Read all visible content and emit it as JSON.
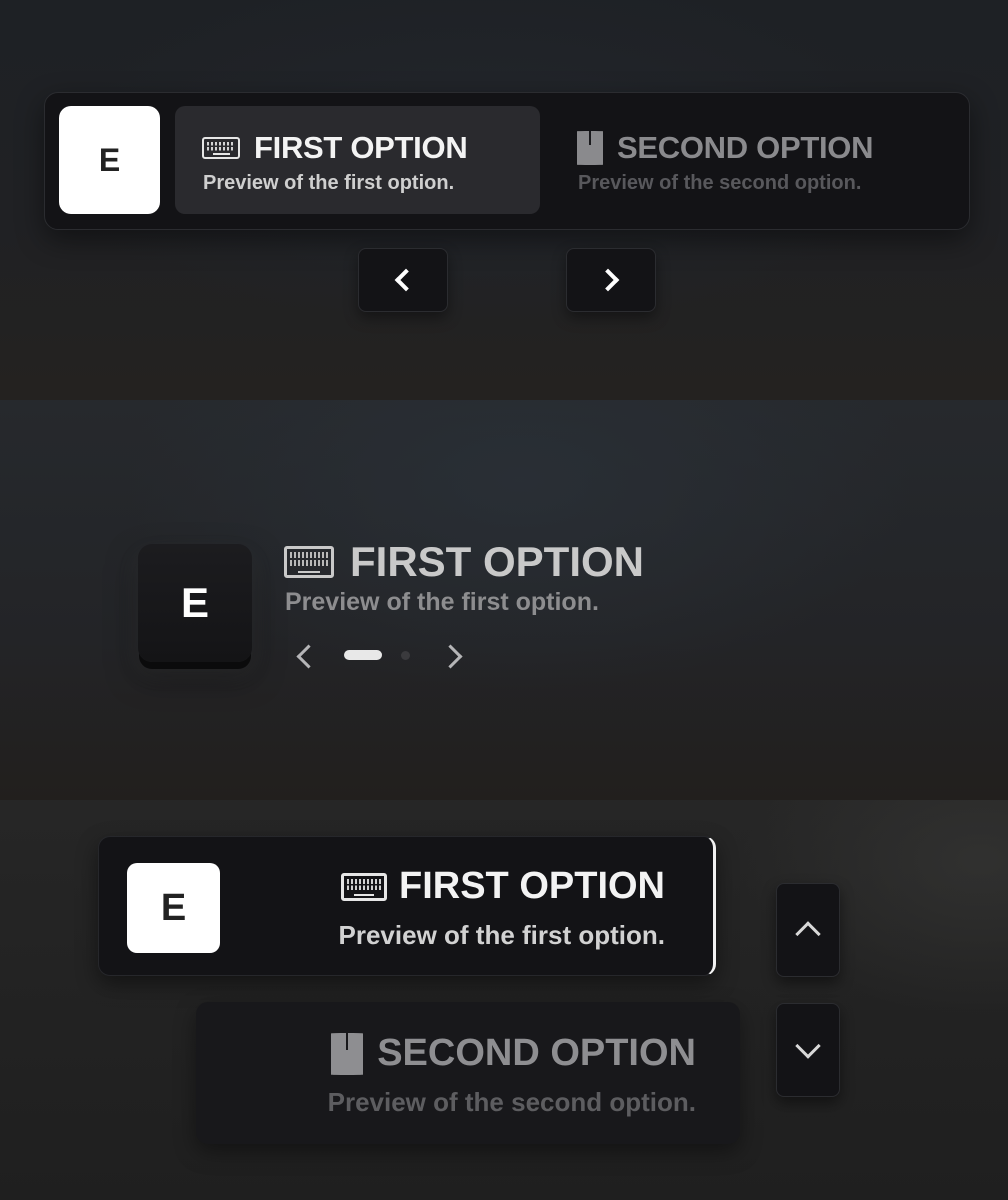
{
  "panel_horizontal": {
    "key_label": "E",
    "options": [
      {
        "title": "FIRST OPTION",
        "subtitle": "Preview of the first option.",
        "icon": "keyboard-icon",
        "active": true
      },
      {
        "title": "SECOND OPTION",
        "subtitle": "Preview of the second option.",
        "icon": "mouse-icon",
        "active": false
      }
    ],
    "prev_icon": "chevron-left-icon",
    "next_icon": "chevron-right-icon"
  },
  "panel_compact": {
    "key_label": "E",
    "title": "FIRST OPTION",
    "subtitle": "Preview of the first option.",
    "icon": "keyboard-icon",
    "page_index": 1,
    "page_count": 2,
    "prev_icon": "chevron-left-icon",
    "next_icon": "chevron-right-icon"
  },
  "panel_vertical": {
    "key_label": "E",
    "options": [
      {
        "title": "FIRST OPTION",
        "subtitle": "Preview of the first option.",
        "icon": "keyboard-icon",
        "active": true
      },
      {
        "title": "SECOND OPTION",
        "subtitle": "Preview of the second option.",
        "icon": "mouse-icon",
        "active": false
      }
    ],
    "up_icon": "chevron-up-icon",
    "down_icon": "chevron-down-icon"
  },
  "colors": {
    "card_background": "#131316",
    "active_option_background": "#2a2a2e",
    "key_background": "#ffffff",
    "active_text": "#f3f3f3",
    "inactive_text": "#8a8a8d",
    "active_indicator": "#f2f2f2"
  }
}
